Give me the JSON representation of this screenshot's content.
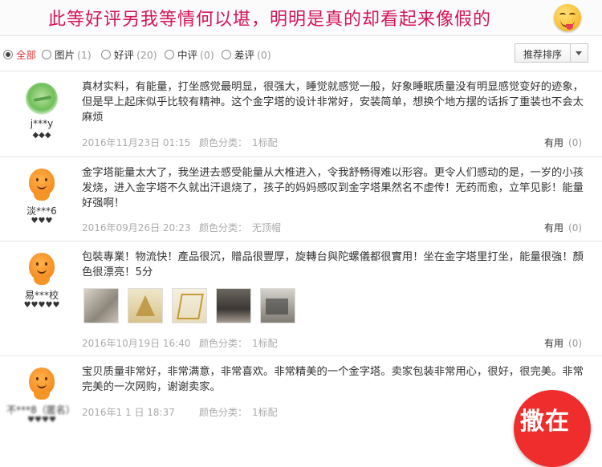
{
  "banner": {
    "title": "此等好评另我等情何以堪，明明是真的却看起来像假的"
  },
  "filters": [
    {
      "label": "全部",
      "count": "",
      "selected": true
    },
    {
      "label": "图片",
      "count": "(1)",
      "selected": false
    },
    {
      "label": "好评",
      "count": "(20)",
      "selected": false
    },
    {
      "label": "中评",
      "count": "(0)",
      "selected": false
    },
    {
      "label": "差评",
      "count": "(0)",
      "selected": false
    }
  ],
  "sort": {
    "label": "推荐排序"
  },
  "reviews": [
    {
      "username": "j***y",
      "badges": "◆◆◆",
      "content": "真材实料，有能量，打坐感觉最明显，很强大，睡觉就感觉一般，好象睡眠质量没有明显感觉变好的迹象，但是早上起床似乎比较有精神。这个金字塔的设计非常好，安装简单，想换个地方摆的话拆了重装也不会太麻烦",
      "date": "2016年11月23日 01:15",
      "color_label": "颜色分类：",
      "color_value": "1标配",
      "useful_label": "有用",
      "useful_count": "(0)"
    },
    {
      "username": "淡***6",
      "badges": "♥♥♥",
      "content": "金字塔能量太大了，我坐进去感受能量从大椎进入，令我舒畅得难以形容。更令人们感动的是，一岁的小孩发烧，进入金字塔不久就出汗退烧了，孩子的妈妈感叹到金字塔果然名不虚传！无药而愈，立竿见影！能量好强啊！",
      "date": "2016年09月26日 20:23",
      "color_label": "颜色分类：",
      "color_value": "无顶帽",
      "useful_label": "有用",
      "useful_count": "(0)"
    },
    {
      "username": "易***校",
      "badges": "♥♥♥♥♥",
      "content": "包裝專業！物流快！產品很沉，贈品很豐厚，旋轉台與陀螺儀都很實用！坐在金字塔里打坐，能量很強！顏色很漂亮！5分",
      "date": "2016年10月19日 16:40",
      "color_label": "颜色分类：",
      "color_value": "1标配",
      "useful_label": "有用",
      "useful_count": "(0)"
    },
    {
      "username": "不***8（匿名）",
      "badges": "♥♥♥♥",
      "content": "宝贝质量非常好，非常满意，非常喜欢。非常精美的一个金字塔。卖家包装非常用心，很好，很完美。非常完美的一次网购，谢谢卖家。",
      "date": "2016年1 1 日 18:37",
      "color_label": "颜色分类：",
      "color_value": "1标配"
    }
  ],
  "sticker": {
    "text": "撒在"
  }
}
